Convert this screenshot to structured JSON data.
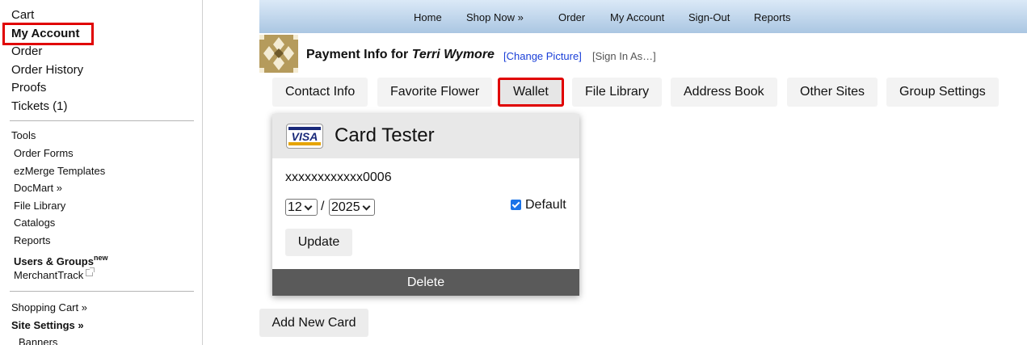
{
  "sidebar": {
    "main_items": [
      "Cart",
      "My Account",
      "Order",
      "Order History",
      "Proofs",
      "Tickets (1)"
    ],
    "tools_title": "Tools",
    "tools_items": [
      "Order Forms",
      "ezMerge Templates",
      "DocMart »",
      "File Library",
      "Catalogs",
      "Reports",
      "Users & Groups",
      "MerchantTrack"
    ],
    "users_groups_badge": "new",
    "bottom_items": [
      "Shopping Cart »",
      "Site Settings »",
      "Banners"
    ]
  },
  "topnav": [
    "Home",
    "Shop Now »",
    "Order",
    "My Account",
    "Sign-Out",
    "Reports"
  ],
  "header": {
    "title_prefix": "Payment Info for ",
    "user_name": "Terri Wymore",
    "change_picture": "[Change Picture]",
    "sign_in_as": "[Sign In As…]"
  },
  "tabs": [
    "Contact Info",
    "Favorite Flower",
    "Wallet",
    "File Library",
    "Address Book",
    "Other Sites",
    "Group Settings"
  ],
  "active_tab": "Wallet",
  "card": {
    "brand_icon": "visa-icon",
    "brand_text": "VISA",
    "name": "Card Tester",
    "number": "xxxxxxxxxxxx0006",
    "exp_month": "12",
    "exp_separator": "/",
    "exp_year": "2025",
    "default_label": "Default",
    "default_checked": true,
    "update_label": "Update",
    "delete_label": "Delete"
  },
  "add_card_label": "Add New Card",
  "colors": {
    "highlight": "#e00000",
    "link": "#1a3fd8",
    "checkbox": "#1a73e8",
    "delete_bar": "#5a5a5a"
  }
}
